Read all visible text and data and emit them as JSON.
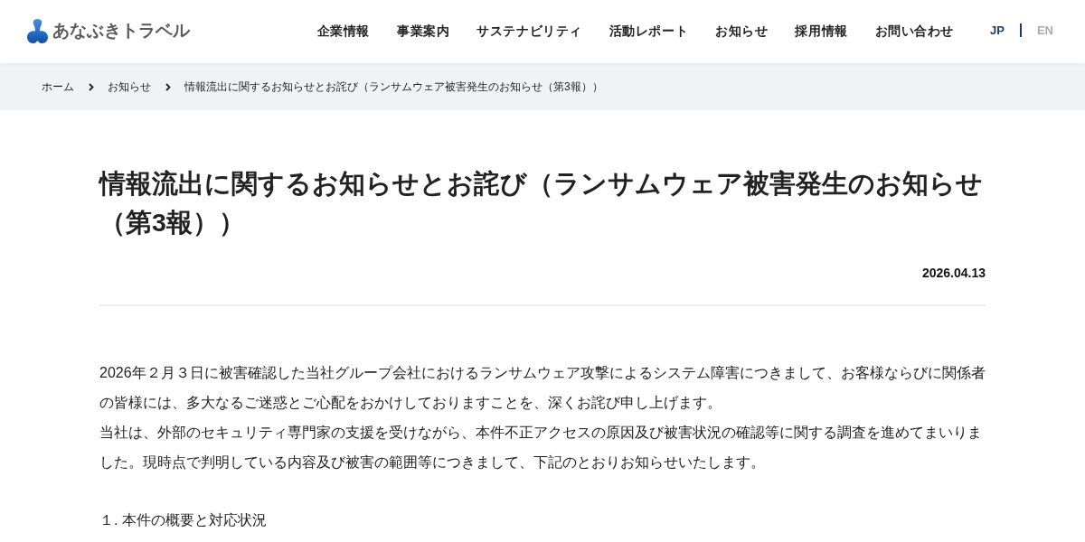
{
  "header": {
    "logo": {
      "text": "あなぶきトラベル"
    },
    "nav": [
      {
        "label": "企業情報"
      },
      {
        "label": "事業案内"
      },
      {
        "label": "サステナビリティ"
      },
      {
        "label": "活動レポート"
      },
      {
        "label": "お知らせ"
      },
      {
        "label": "採用情報"
      },
      {
        "label": "お問い合わせ"
      }
    ],
    "languages": [
      {
        "label": "JP",
        "selected": true
      },
      {
        "label": "EN",
        "selected": false
      }
    ]
  },
  "breadcrumb": [
    {
      "label": "ホーム"
    },
    {
      "label": "お知らせ"
    },
    {
      "label": "情報流出に関するお知らせとお詫び（ランサムウェア被害発生のお知らせ（第3報））"
    }
  ],
  "article": {
    "title": "情報流出に関するお知らせとお詫び（ランサムウェア被害発生のお知らせ（第3報））",
    "date": "2026.04.13",
    "paragraphs": [
      "2026年２月３日に被害確認した当社グループ会社におけるランサムウェア攻撃によるシステム障害につきまして、お客様ならびに関係者の皆様には、多大なるご迷惑とご心配をおかけしておりますことを、深くお詫び申し上げます。",
      "当社は、外部のセキュリティ専門家の支援を受けながら、本件不正アクセスの原因及び被害状況の確認等に関する調査を進めてまいりました。現時点で判明している内容及び被害の範囲等につきまして、下記のとおりお知らせいたします。"
    ],
    "section_heading": "１. 本件の概要と対応状況"
  }
}
